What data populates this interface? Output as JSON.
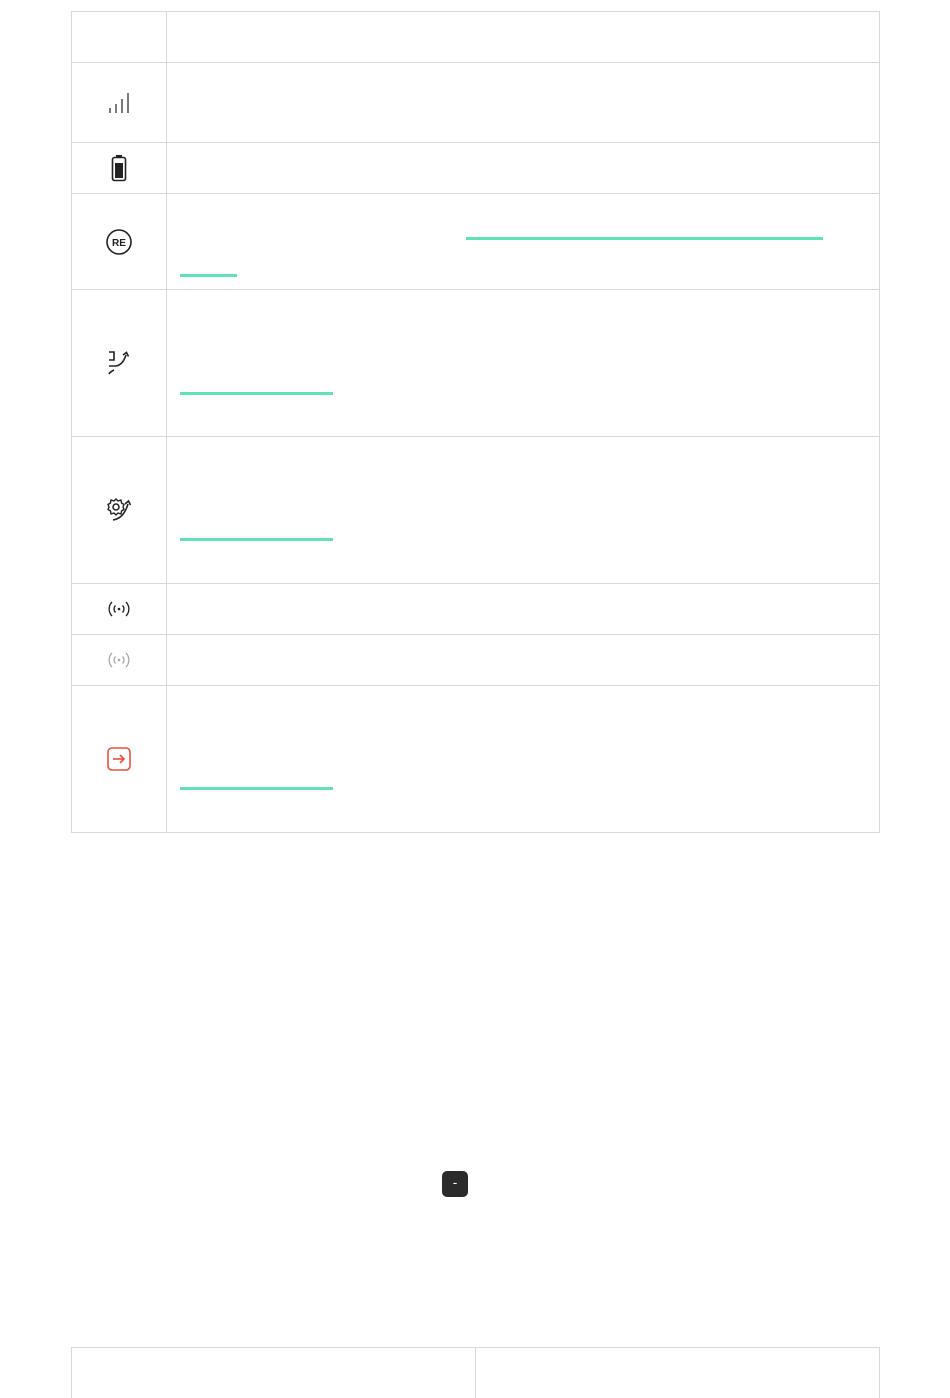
{
  "icon_table": {
    "rows": [
      {
        "icon": "none",
        "description": ""
      },
      {
        "icon": "signal-bars-icon",
        "description": ""
      },
      {
        "icon": "battery-icon",
        "description": ""
      },
      {
        "icon": "re-badge-icon",
        "description": "",
        "has_link": true
      },
      {
        "icon": "tamper-arrow-icon",
        "description": "",
        "has_link": true
      },
      {
        "icon": "gear-arrow-icon",
        "description": "",
        "has_link": true
      },
      {
        "icon": "radio-waves-icon",
        "description": ""
      },
      {
        "icon": "radio-waves-faded-icon",
        "description": ""
      },
      {
        "icon": "exit-arrow-icon",
        "description": "",
        "has_link": true,
        "icon_color": "#e8503a"
      }
    ]
  },
  "colors": {
    "link_accent": "#5fe3b2",
    "border": "#d9d9d9",
    "exit_icon": "#e8503a",
    "button_dark": "#2b2b2b"
  },
  "controls": {
    "minus_label": "-"
  },
  "bottom_table": {
    "cells": [
      "",
      ""
    ]
  }
}
